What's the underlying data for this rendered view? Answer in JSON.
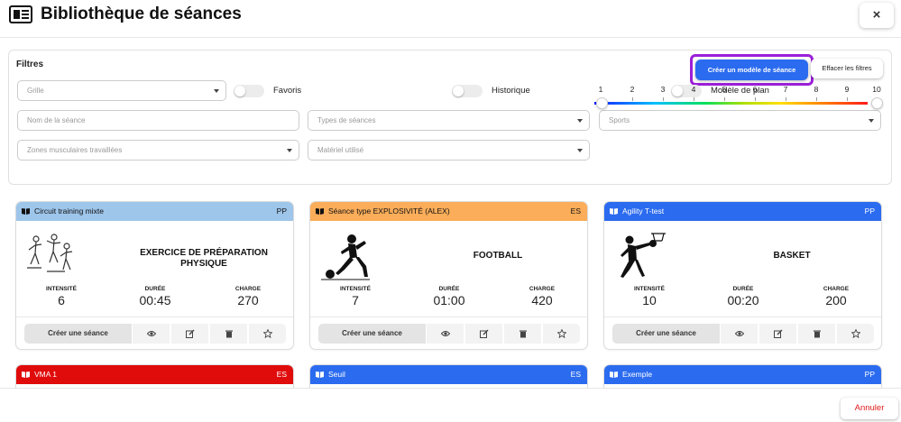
{
  "header": {
    "title": "Bibliothèque de séances",
    "close_label": "×"
  },
  "filters": {
    "label": "Filtres",
    "create_model_label": "Créer un modèle de séance",
    "clear_label": "Effacer les filtres",
    "grille_placeholder": "Grille",
    "favoris_label": "Favoris",
    "historique_label": "Historique",
    "modele_plan_label": "Modèle de plan",
    "nom_placeholder": "Nom de la séance",
    "types_placeholder": "Types de séances",
    "sports_placeholder": "Sports",
    "zones_placeholder": "Zones musculaires travaillées",
    "materiel_placeholder": "Matériel utilisé",
    "slider_ticks": [
      "1",
      "2",
      "3",
      "4",
      "5",
      "6",
      "7",
      "8",
      "9",
      "10"
    ],
    "slider_range": [
      1,
      10
    ]
  },
  "metric_labels": {
    "intensity": "INTENSITÉ",
    "duration": "DURÉE",
    "load": "CHARGE"
  },
  "cards": [
    {
      "name": "Circuit training mixte",
      "tag": "PP",
      "color": "#9ec5ea",
      "text_color": "#111111",
      "sport": "EXERCICE DE PRÉPARATION PHYSIQUE",
      "intensity": "6",
      "duration": "00:45",
      "load": "270",
      "action_label": "Créer une séance"
    },
    {
      "name": "Séance type EXPLOSIVITÉ (ALEX)",
      "tag": "ES",
      "color": "#fbad5a",
      "text_color": "#111111",
      "sport": "FOOTBALL",
      "intensity": "7",
      "duration": "01:00",
      "load": "420",
      "action_label": "Créer une séance"
    },
    {
      "name": "Agility T-test",
      "tag": "PP",
      "color": "#2b6bef",
      "text_color": "#ffffff",
      "sport": "BASKET",
      "intensity": "10",
      "duration": "00:20",
      "load": "200",
      "action_label": "Créer une séance"
    },
    {
      "name": "VMA 1",
      "tag": "ES",
      "color": "#e00b0b",
      "text_color": "#ffffff"
    },
    {
      "name": "Seuil",
      "tag": "ES",
      "color": "#2b6bef",
      "text_color": "#ffffff"
    },
    {
      "name": "Exemple",
      "tag": "PP",
      "color": "#2b6bef",
      "text_color": "#ffffff"
    }
  ],
  "footer": {
    "cancel_label": "Annuler"
  }
}
